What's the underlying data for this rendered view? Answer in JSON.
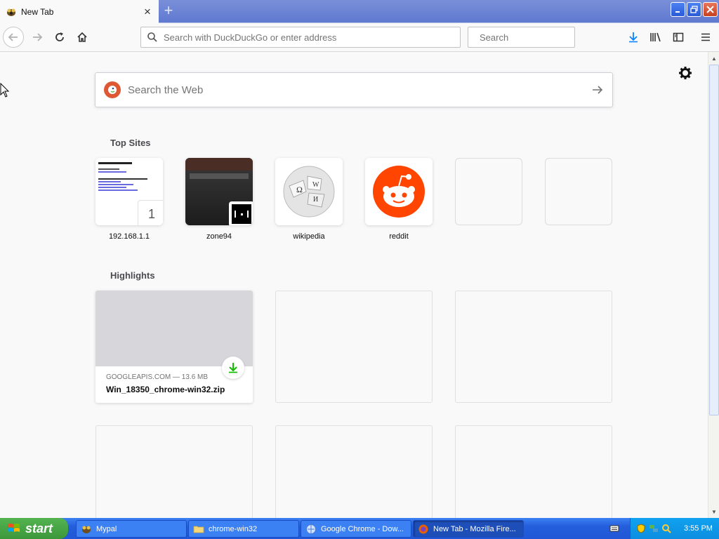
{
  "browser": {
    "tab": {
      "title": "New Tab",
      "close_label": "×"
    },
    "new_tab_label": "+",
    "window_buttons": {
      "minimize": "‗",
      "restore": "❐",
      "close": "✕"
    },
    "urlbar": {
      "placeholder": "Search with DuckDuckGo or enter address",
      "value": ""
    },
    "searchbar": {
      "placeholder": "Search",
      "value": ""
    }
  },
  "newtab": {
    "web_search": {
      "placeholder": "Search the Web"
    },
    "top_sites_title": "Top Sites",
    "top_sites": [
      {
        "label": "192.168.1.1",
        "badge": "1"
      },
      {
        "label": "zone94"
      },
      {
        "label": "wikipedia"
      },
      {
        "label": "reddit"
      },
      {
        "label": ""
      },
      {
        "label": ""
      }
    ],
    "highlights_title": "Highlights",
    "highlight": {
      "source": "GOOGLEAPIS.COM — 13.6 MB",
      "filename": "Win_18350_chrome-win32.zip"
    }
  },
  "taskbar": {
    "start_label": "start",
    "tasks": [
      {
        "label": "Mypal"
      },
      {
        "label": "chrome-win32"
      },
      {
        "label": "Google Chrome - Dow..."
      },
      {
        "label": "New Tab - Mozilla Fire..."
      }
    ],
    "clock": "3:55 PM"
  },
  "colors": {
    "accent": "#0a84ff",
    "download_green": "#12bc00",
    "reddit": "#ff4500",
    "ddg": "#de5833"
  }
}
